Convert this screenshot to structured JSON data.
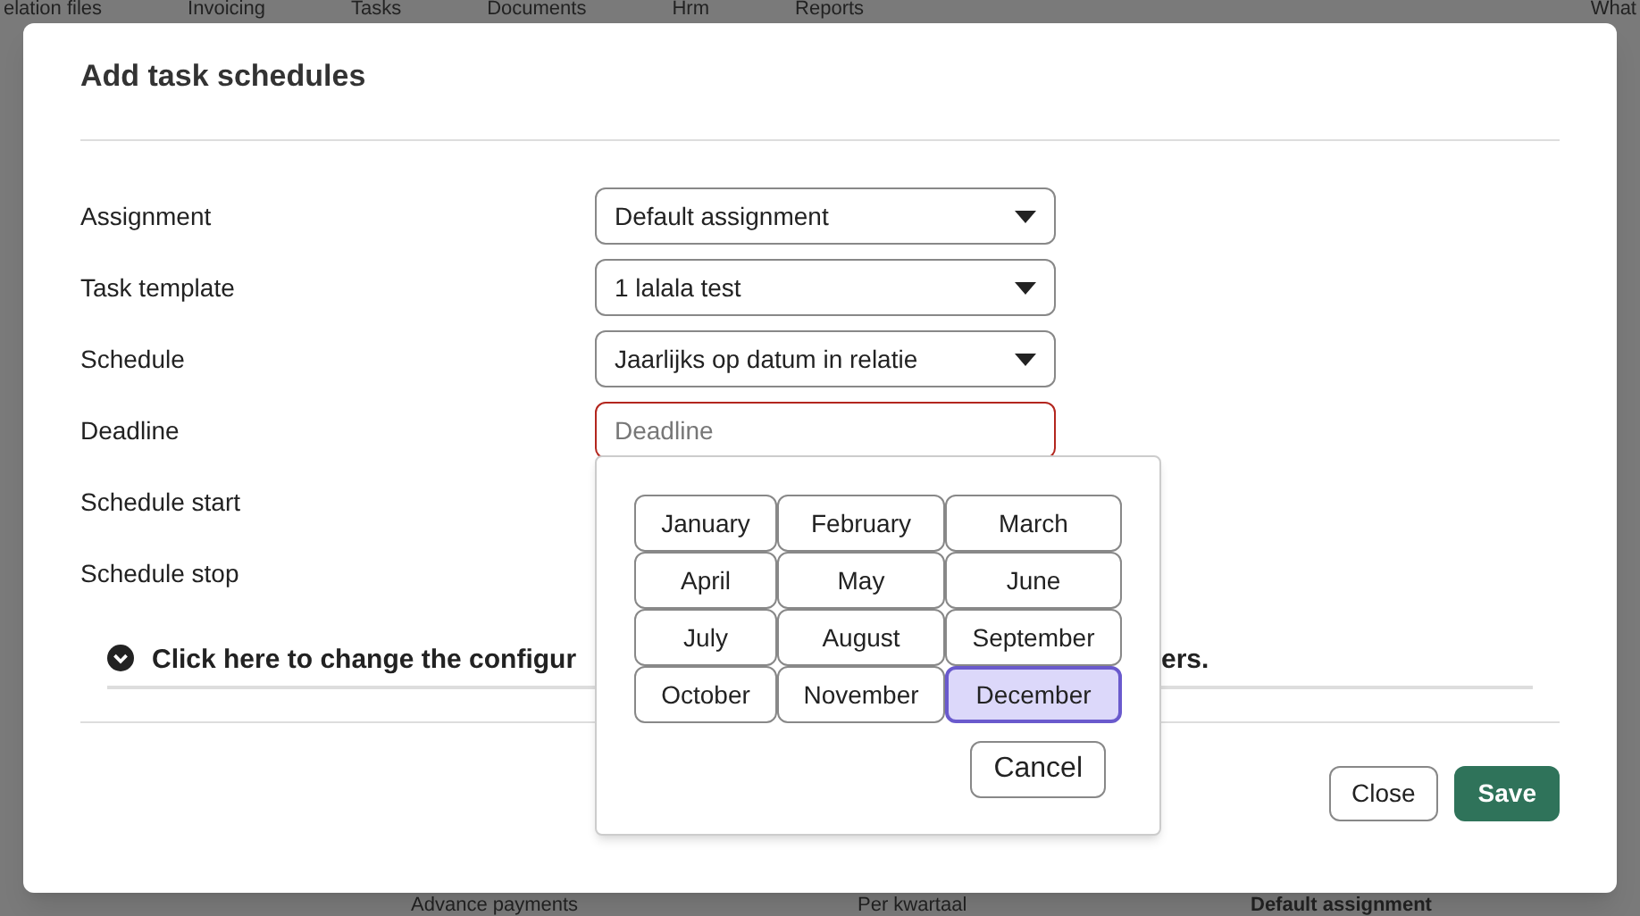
{
  "background": {
    "nav": [
      "elation files",
      "Invoicing",
      "Tasks",
      "Documents",
      "Hrm",
      "Reports",
      "What"
    ],
    "bottom_row": [
      "Advance payments",
      "Per kwartaal",
      "Default assignment"
    ]
  },
  "dialog": {
    "title": "Add task schedules",
    "fields": [
      {
        "label": "Assignment",
        "kind": "select",
        "value": "Default assignment"
      },
      {
        "label": "Task template",
        "kind": "select",
        "value": "1 lalala test"
      },
      {
        "label": "Schedule",
        "kind": "select",
        "value": "Jaarlijks op datum in relatie"
      },
      {
        "label": "Deadline",
        "kind": "text",
        "placeholder": "Deadline",
        "invalid": true
      },
      {
        "label": "Schedule start",
        "kind": "hidden"
      },
      {
        "label": "Schedule stop",
        "kind": "hidden"
      }
    ],
    "config_toggle": {
      "text_start": "Click here to change the configur",
      "text_end": "ers.",
      "expanded": false
    },
    "buttons": [
      {
        "label": "Close",
        "kind": "secondary"
      },
      {
        "label": "Save",
        "kind": "primary"
      }
    ]
  },
  "month_picker": {
    "months": [
      {
        "label": "January",
        "selected": false
      },
      {
        "label": "February",
        "selected": false
      },
      {
        "label": "March",
        "selected": false
      },
      {
        "label": "April",
        "selected": false
      },
      {
        "label": "May",
        "selected": false
      },
      {
        "label": "June",
        "selected": false
      },
      {
        "label": "July",
        "selected": false
      },
      {
        "label": "August",
        "selected": false
      },
      {
        "label": "September",
        "selected": false
      },
      {
        "label": "October",
        "selected": false
      },
      {
        "label": "November",
        "selected": false
      },
      {
        "label": "December",
        "selected": true
      }
    ],
    "cancel": "Cancel"
  }
}
